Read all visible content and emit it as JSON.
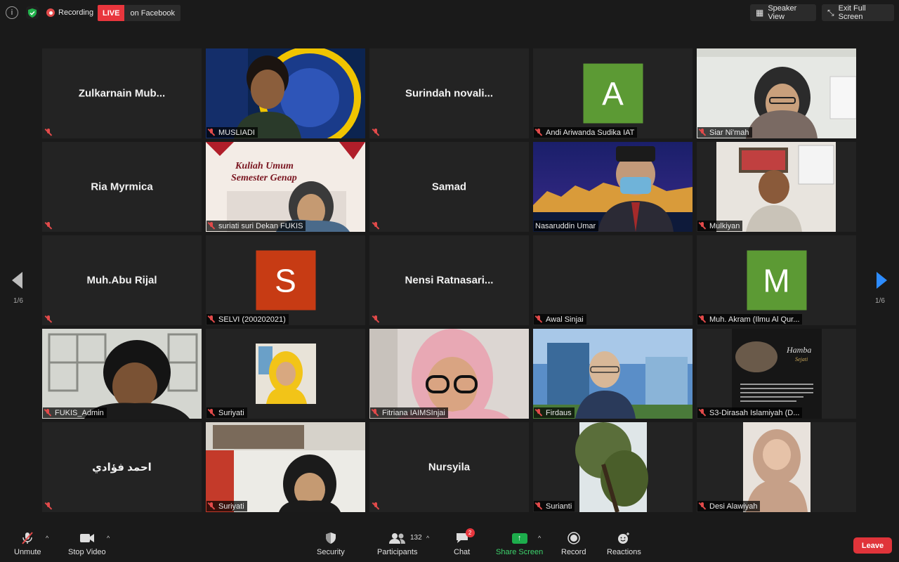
{
  "topbar": {
    "recording_label": "Recording",
    "live_tag": "LIVE",
    "live_text": "on Facebook",
    "speaker_view": "Speaker View",
    "exit_full_screen": "Exit Full Screen"
  },
  "pager": {
    "left": "1/6",
    "right": "1/6"
  },
  "tiles": [
    {
      "name": "Zulkarnain  Mub...",
      "label": ""
    },
    {
      "name": "",
      "label": "MUSLIADI"
    },
    {
      "name": "Surindah  novali...",
      "label": ""
    },
    {
      "name": "",
      "label": "Andi Ariwanda Sudika IAT",
      "avatar": "A"
    },
    {
      "name": "",
      "label": "Siar Ni'mah"
    },
    {
      "name": "Ria Myrmica",
      "label": ""
    },
    {
      "name": "",
      "label": "suriati suri Dekan FUKIS"
    },
    {
      "name": "Samad",
      "label": ""
    },
    {
      "name": "",
      "label": "Nasaruddin Umar"
    },
    {
      "name": "",
      "label": "Mulkiyan"
    },
    {
      "name": "Muh.Abu Rijal",
      "label": ""
    },
    {
      "name": "",
      "label": "SELVI (200202021)",
      "avatar": "S"
    },
    {
      "name": "Nensi  Ratnasari...",
      "label": ""
    },
    {
      "name": "",
      "label": "Awal Sinjai"
    },
    {
      "name": "",
      "label": "Muh. Akram (Ilmu Al Qur...",
      "avatar": "M"
    },
    {
      "name": "",
      "label": "FUKIS_Admin"
    },
    {
      "name": "",
      "label": "Suriyati"
    },
    {
      "name": "",
      "label": "Fitriana IAIMSInjai"
    },
    {
      "name": "",
      "label": "Firdaus"
    },
    {
      "name": "",
      "label": "S3-Dirasah Islamiyah (D..."
    },
    {
      "name": "احمد فؤادي",
      "label": ""
    },
    {
      "name": "",
      "label": "Suriyati"
    },
    {
      "name": "Nursyila",
      "label": ""
    },
    {
      "name": "",
      "label": "Surianti"
    },
    {
      "name": "",
      "label": "Desi Alawiyah"
    }
  ],
  "toolbar": {
    "unmute": "Unmute",
    "stop_video": "Stop Video",
    "security": "Security",
    "participants": "Participants",
    "participants_count": "132",
    "chat": "Chat",
    "chat_badge": "2",
    "share_screen": "Share Screen",
    "record": "Record",
    "reactions": "Reactions",
    "leave": "Leave"
  },
  "colors": {
    "avatar_A": "#5c9a34",
    "avatar_S": "#c73b14",
    "avatar_M": "#5c9a34",
    "live": "#e8363d",
    "active_speaker": "#d6e36a",
    "share": "#1dad4c",
    "leave": "#e0343a"
  }
}
